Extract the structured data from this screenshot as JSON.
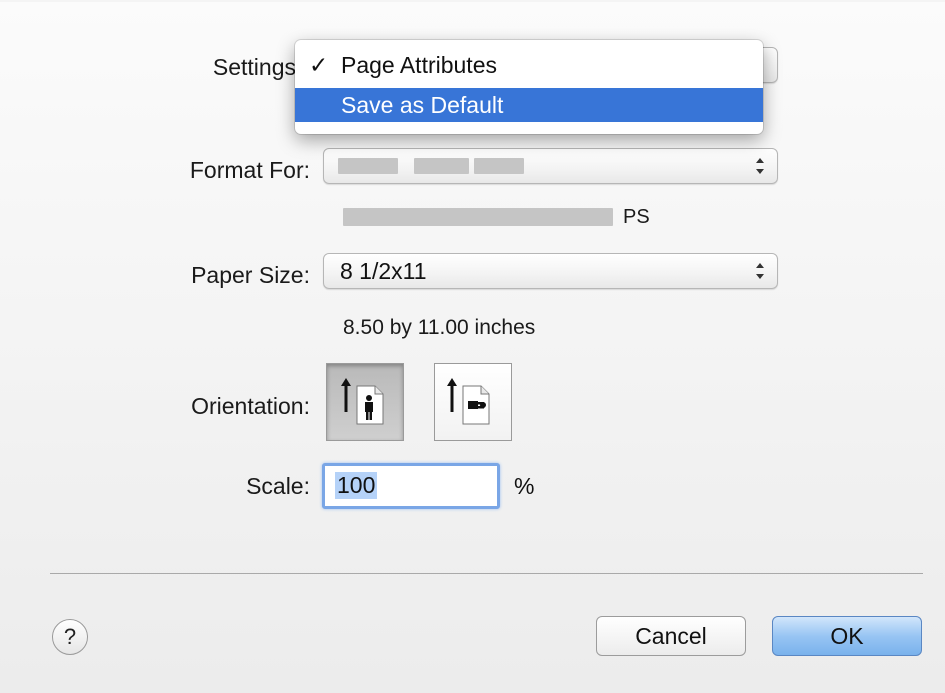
{
  "settings": {
    "label": "Settings",
    "menu_items": [
      {
        "check": "✓",
        "label": "Page Attributes"
      },
      {
        "check": "",
        "label": "Save as Default"
      }
    ]
  },
  "format_for": {
    "label": "Format For:",
    "suffix": "PS"
  },
  "paper_size": {
    "label": "Paper Size:",
    "value": "8 1/2x11",
    "dimensions": "8.50 by 11.00 inches"
  },
  "orientation": {
    "label": "Orientation:",
    "options": [
      "portrait",
      "landscape"
    ],
    "selected": "portrait"
  },
  "scale": {
    "label": "Scale:",
    "value": "100",
    "unit": "%"
  },
  "buttons": {
    "help": "?",
    "cancel": "Cancel",
    "ok": "OK"
  },
  "colors": {
    "menu_highlight": "#3875d7",
    "default_button": "#79b2ec"
  }
}
